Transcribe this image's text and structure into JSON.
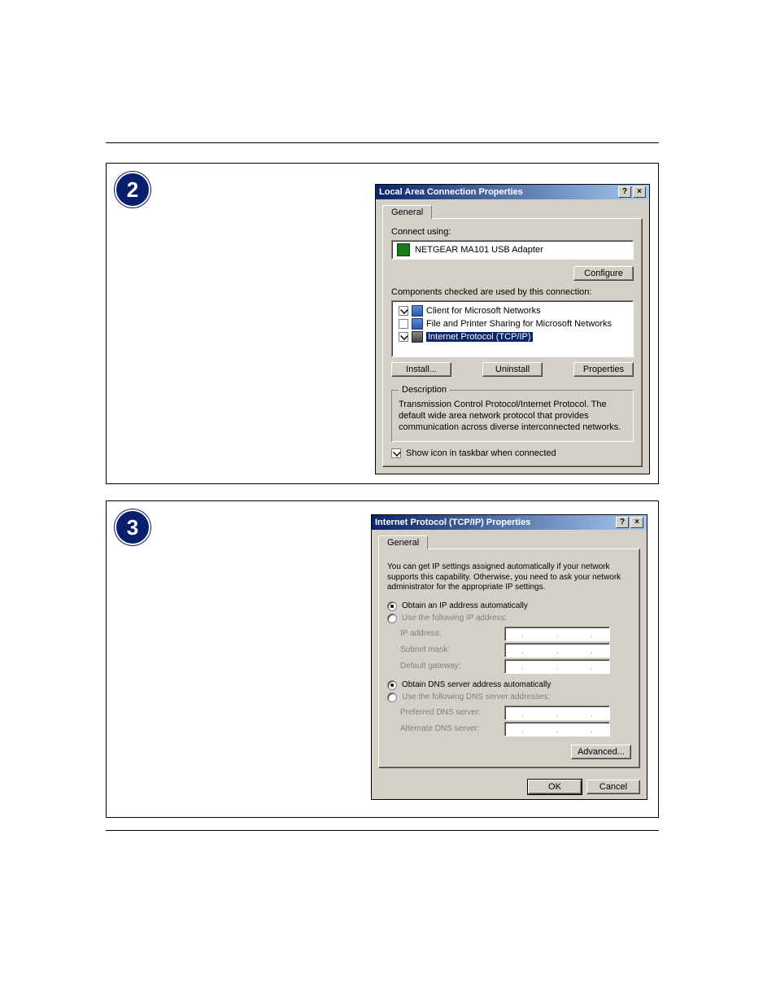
{
  "badge2": "2",
  "badge3": "3",
  "dialog1": {
    "title": "Local Area Connection Properties",
    "tab": "General",
    "connect_using_label": "Connect using:",
    "adapter_name": "NETGEAR MA101 USB Adapter",
    "configure_btn": "Configure",
    "components_label": "Components checked are used by this connection:",
    "components": [
      {
        "checked": true,
        "label": "Client for Microsoft Networks",
        "icon": "mon",
        "selected": false
      },
      {
        "checked": false,
        "label": "File and Printer Sharing for Microsoft Networks",
        "icon": "share",
        "selected": false
      },
      {
        "checked": true,
        "label": "Internet Protocol (TCP/IP)",
        "icon": "tcp",
        "selected": true
      }
    ],
    "install_btn": "Install...",
    "uninstall_btn": "Uninstall",
    "properties_btn": "Properties",
    "description_legend": "Description",
    "description_text": "Transmission Control Protocol/Internet Protocol. The default wide area network protocol that provides communication across diverse interconnected networks.",
    "show_icon_label": "Show icon in taskbar when connected"
  },
  "dialog2": {
    "title": "Internet Protocol (TCP/IP) Properties",
    "tab": "General",
    "intro": "You can get IP settings assigned automatically if your network supports this capability. Otherwise, you need to ask your network administrator for the appropriate IP settings.",
    "ip_auto": "Obtain an IP address automatically",
    "ip_manual": "Use the following IP address:",
    "ip_label": "IP address:",
    "subnet_label": "Subnet mask:",
    "gateway_label": "Default gateway:",
    "dns_auto": "Obtain DNS server address automatically",
    "dns_manual": "Use the following DNS server addresses:",
    "pref_dns": "Preferred DNS server:",
    "alt_dns": "Alternate DNS server:",
    "advanced_btn": "Advanced...",
    "ok_btn": "OK",
    "cancel_btn": "Cancel"
  },
  "help_glyph": "?",
  "close_glyph": "×"
}
